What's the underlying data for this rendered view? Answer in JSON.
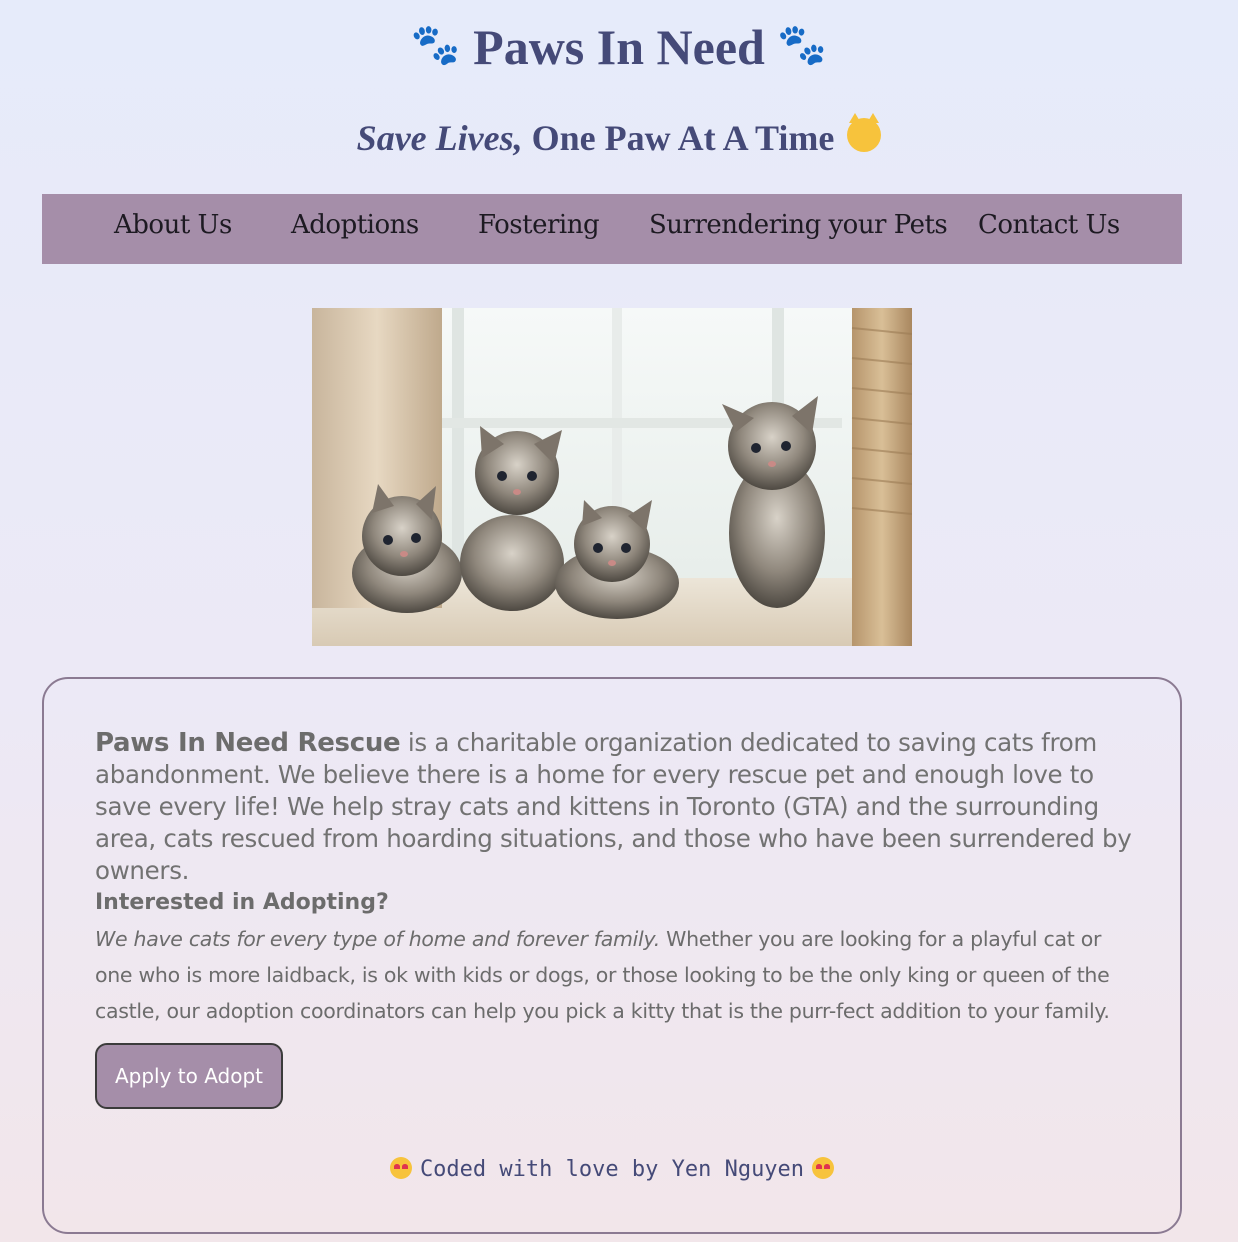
{
  "header": {
    "title": "Paws In Need",
    "paw_glyph": "🐾",
    "tagline_italic": "Save Lives,",
    "tagline_rest": " One Paw At A Time",
    "tagline_icon": "grinning-cat-icon"
  },
  "nav": {
    "items": [
      {
        "label": "About Us"
      },
      {
        "label": "Adoptions"
      },
      {
        "label": "Fostering"
      },
      {
        "label": "Surrendering your Pets"
      },
      {
        "label": "Contact Us"
      }
    ]
  },
  "hero": {
    "image": "kittens-photo"
  },
  "card": {
    "intro_strong": "Paws In Need Rescue",
    "intro_rest": " is a charitable organization dedicated to saving cats from abandonment. We believe there is a home for every rescue pet and enough love to save every life! We help stray cats and kittens in Toronto (GTA) and the surrounding area, cats rescued from hoarding situations, and those who have been surrendered by owners.",
    "adopt_heading": "Interested in Adopting?",
    "adopt_italic": "We have cats for every type of home and forever family.",
    "adopt_rest": " Whether you are looking for a playful cat or one who is more laidback, is ok with kids or dogs, or those looking to be the only king or queen of the castle, our adoption coordinators can help you pick a kitty that is the purr-fect addition to your family.",
    "apply_label": "Apply to Adopt",
    "footer_text": "Coded with love by Yen Nguyen",
    "footer_icon": "heart-eyes-cat-icon"
  },
  "colors": {
    "nav_bg": "#a58ea9",
    "title": "#454a78",
    "body_text": "#6c6c6c"
  }
}
